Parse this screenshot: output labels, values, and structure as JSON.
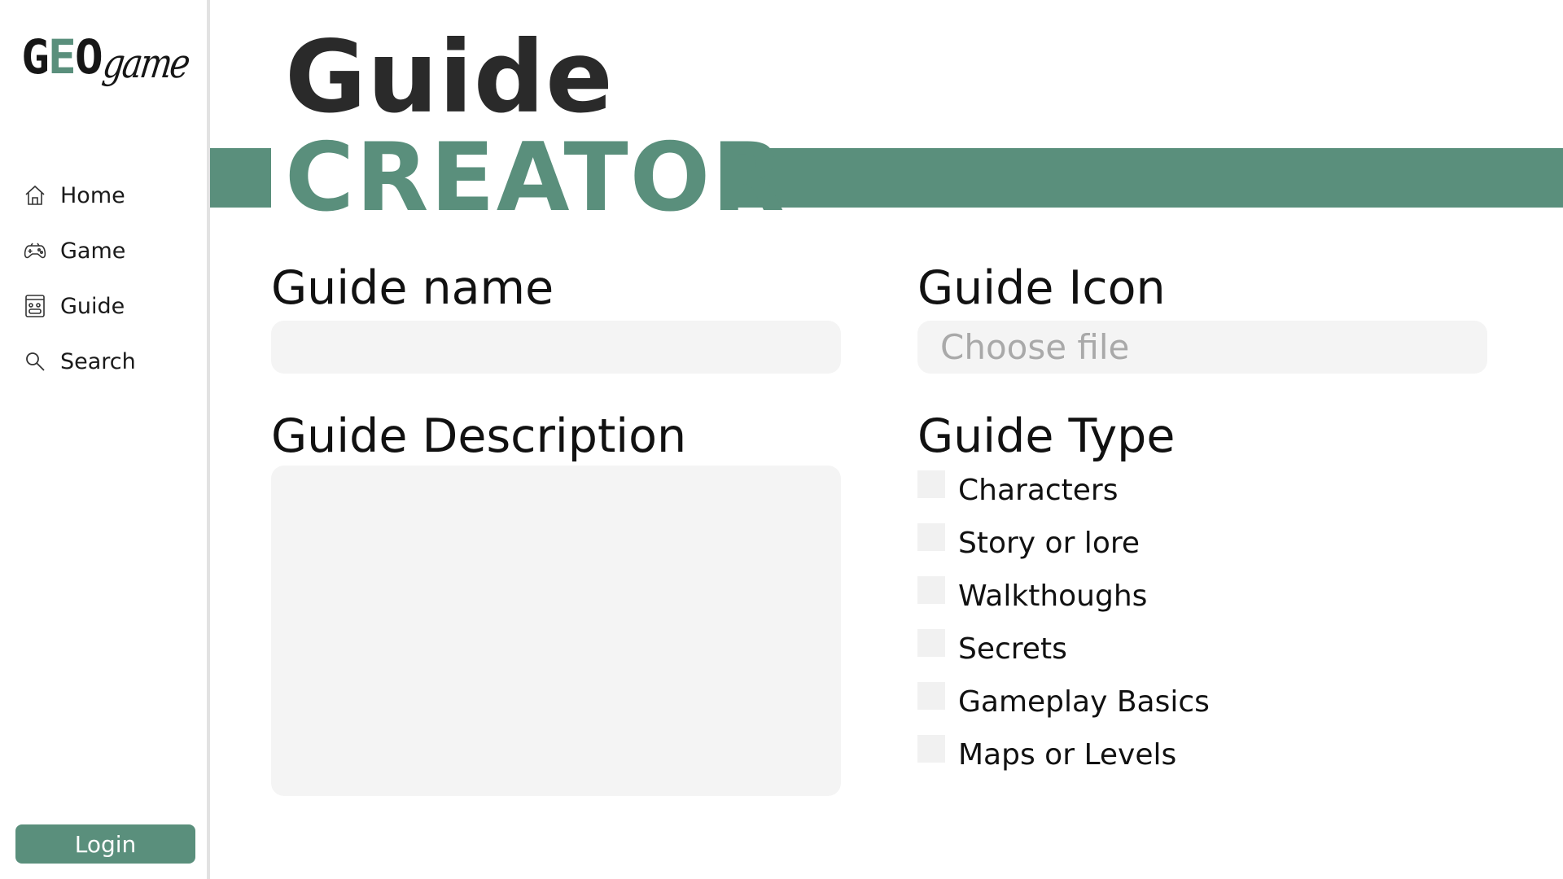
{
  "sidebar": {
    "logo": {
      "geo_prefix": "G",
      "geo_accent": "E",
      "geo_suffix": "O",
      "game": "game"
    },
    "nav": [
      {
        "label": "Home",
        "icon": "home-icon"
      },
      {
        "label": "Game",
        "icon": "gamepad-icon"
      },
      {
        "label": "Guide",
        "icon": "guide-icon"
      },
      {
        "label": "Search",
        "icon": "search-icon"
      }
    ],
    "login_label": "Login"
  },
  "header": {
    "title_line1": "Guide",
    "title_line2": "CREATOR"
  },
  "form": {
    "name_label": "Guide name",
    "name_value": "",
    "icon_label": "Guide Icon",
    "icon_placeholder": "Choose file",
    "description_label": "Guide Description",
    "description_value": "",
    "type_label": "Guide Type",
    "types": [
      {
        "label": "Characters",
        "checked": false
      },
      {
        "label": "Story or lore",
        "checked": false
      },
      {
        "label": "Walkthoughs",
        "checked": false
      },
      {
        "label": "Secrets",
        "checked": false
      },
      {
        "label": "Gameplay Basics",
        "checked": false
      },
      {
        "label": "Maps or Levels",
        "checked": false
      }
    ]
  },
  "colors": {
    "accent": "#5a8f7c",
    "input_bg": "#f4f4f4",
    "text": "#111111"
  }
}
